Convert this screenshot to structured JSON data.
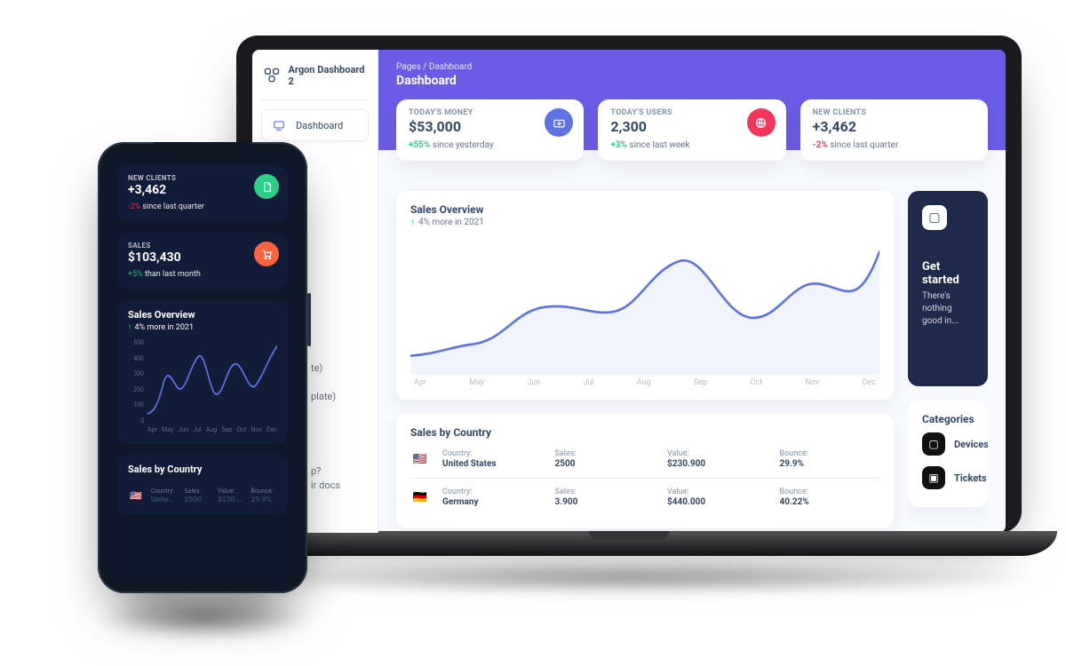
{
  "breadcrumb": {
    "root": "Pages",
    "sep": "/",
    "page": "Dashboard"
  },
  "page_title": "Dashboard",
  "brand": "Argon Dashboard 2",
  "nav": {
    "dashboard": "Dashboard"
  },
  "stats": {
    "money": {
      "label": "TODAY'S MONEY",
      "value": "$53,000",
      "pct": "+55%",
      "note": "since yesterday",
      "dir": "up"
    },
    "users": {
      "label": "TODAY'S USERS",
      "value": "2,300",
      "pct": "+3%",
      "note": "since last week",
      "dir": "up"
    },
    "clients": {
      "label": "NEW CLIENTS",
      "value": "+3,462",
      "pct": "-2%",
      "note": "since last quarter",
      "dir": "down"
    },
    "sales": {
      "label": "SALES",
      "value": "$103,430",
      "pct": "+5%",
      "note": "than last month",
      "dir": "up"
    }
  },
  "overview": {
    "title": "Sales Overview",
    "arrow": "↑",
    "note": "4% more in 2021"
  },
  "tip": {
    "title": "Get started",
    "body": "There's nothing good in..."
  },
  "sales_by_country": {
    "title": "Sales by Country",
    "cols": {
      "country": "Country:",
      "sales": "Sales:",
      "value": "Value:",
      "bounce": "Bounce:"
    },
    "rows": [
      {
        "flag": "🇺🇸",
        "country": "United States",
        "sales": "2500",
        "value": "$230.900",
        "bounce": "29.9%"
      },
      {
        "flag": "🇩🇪",
        "country": "Germany",
        "sales": "3.900",
        "value": "$440.000",
        "bounce": "40.22%"
      }
    ]
  },
  "categories": {
    "title": "Categories",
    "items": [
      {
        "i": "▢",
        "t": "Devices"
      },
      {
        "i": "▣",
        "t": "Tickets"
      }
    ]
  },
  "ghost": {
    "a": "te)",
    "b": "plate)",
    "c": "p?",
    "d": "ir docs"
  },
  "chart_data": {
    "type": "line",
    "title": "Sales Overview",
    "subtitle": "4% more in 2021",
    "x": [
      "Apr",
      "May",
      "Jun",
      "Jul",
      "Aug",
      "Sep",
      "Oct",
      "Nov",
      "Dec"
    ],
    "values": [
      70,
      120,
      270,
      240,
      360,
      490,
      310,
      430,
      350,
      500
    ],
    "ylim": [
      0,
      500
    ],
    "y_ticks": [
      0,
      100,
      200,
      300,
      400,
      500
    ],
    "color": "#5e72e4"
  }
}
